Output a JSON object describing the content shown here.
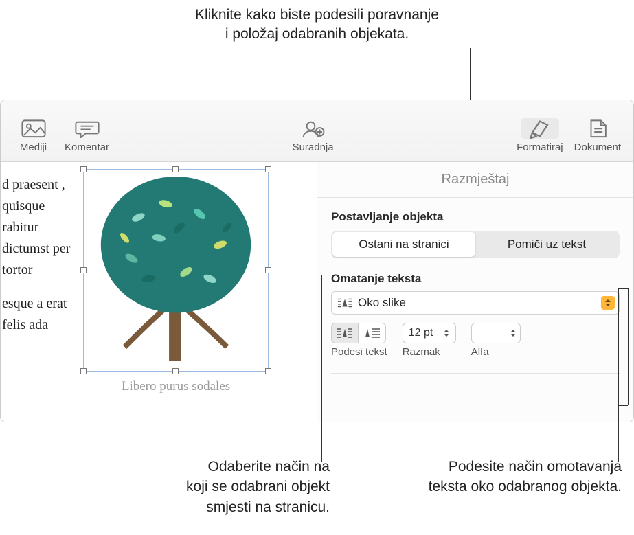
{
  "callouts": {
    "top_line1": "Kliknite kako biste podesili poravnanje",
    "top_line2": "i položaj odabranih objekata.",
    "bottom_left_l1": "Odaberite način na",
    "bottom_left_l2": "koji se odabrani objekt",
    "bottom_left_l3": "smjesti na stranicu.",
    "bottom_right_l1": "Podesite način omotavanja",
    "bottom_right_l2": "teksta oko odabranog objekta."
  },
  "toolbar": {
    "media": "Mediji",
    "comment": "Komentar",
    "collab": "Suradnja",
    "format": "Formatiraj",
    "document": "Dokument"
  },
  "document": {
    "para1": "d praesent , quisque rabitur dictumst per tortor",
    "para2": "esque a erat felis ada",
    "caption": "Libero purus sodales"
  },
  "panel": {
    "tab": "Razmještaj",
    "placement_title": "Postavljanje objekta",
    "seg_stay": "Ostani na stranici",
    "seg_move": "Pomiči uz tekst",
    "wrap_title": "Omatanje teksta",
    "wrap_value": "Oko slike",
    "fit_label": "Podesi tekst",
    "spacing_label": "Razmak",
    "spacing_value": "12 pt",
    "alpha_label": "Alfa",
    "alpha_value": ""
  }
}
